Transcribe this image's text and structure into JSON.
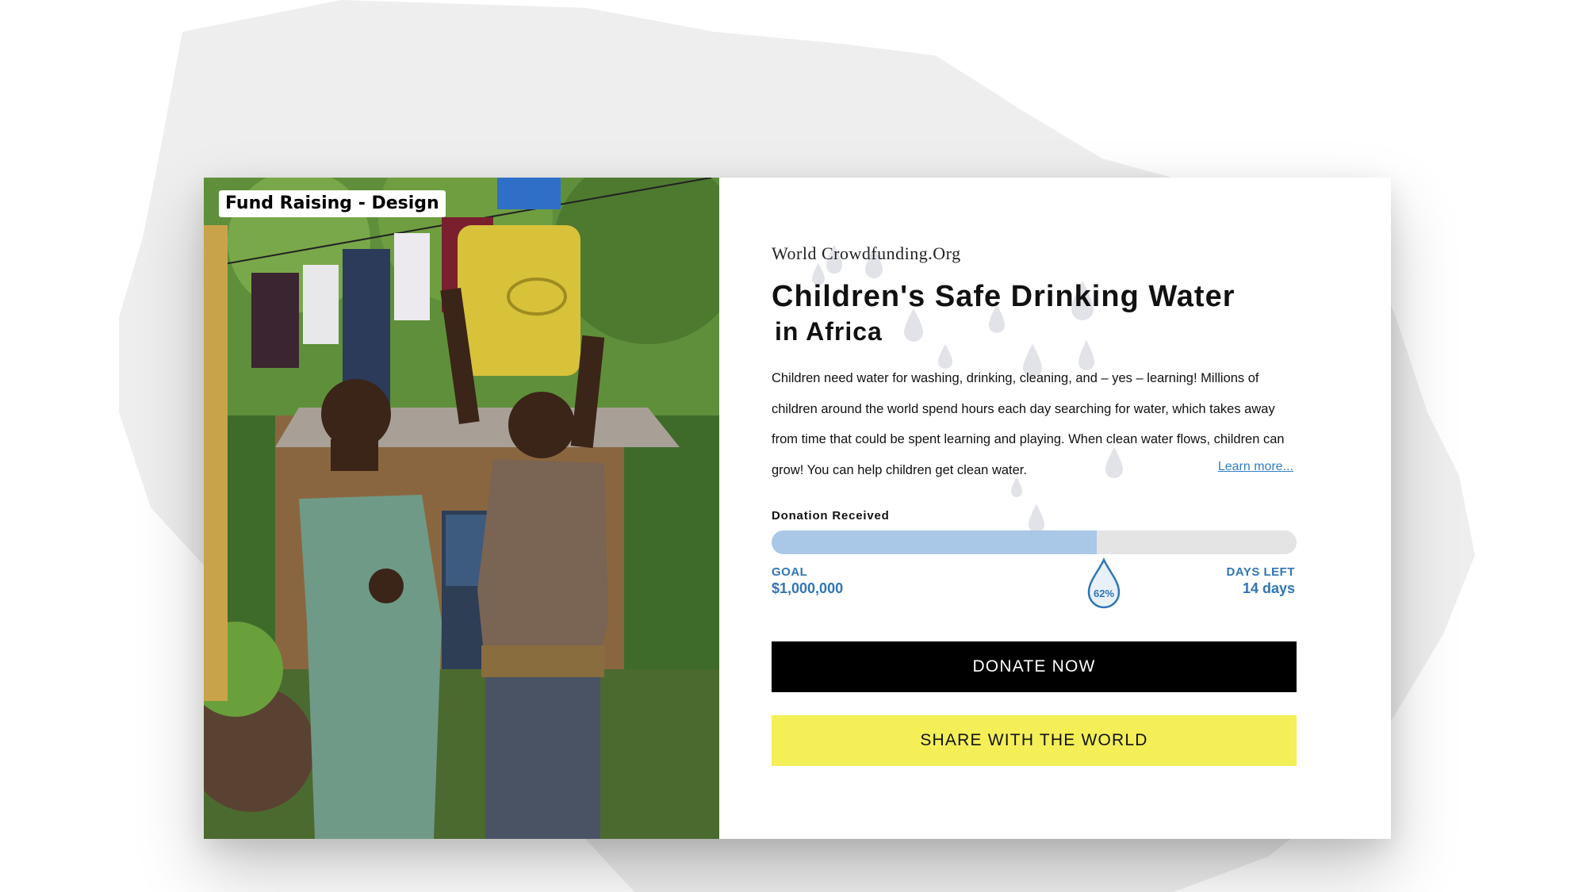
{
  "tag": "Fund Raising - Design",
  "org_name": "World Crowdfunding.Org",
  "title_line1": "Children's Safe Drinking Water",
  "title_line2": "in Africa",
  "description": "Children need water for washing, drinking, cleaning, and – yes – learning! Millions of children around the world spend hours each day searching for water, which takes away from time that could be spent learning and playing. When clean water flows, children can grow! You can help children get clean water.",
  "learn_more": "Learn more...",
  "donation_label": "Donation Received",
  "progress_percent": 62,
  "progress_text": "62%",
  "goal_label": "GOAL",
  "goal_value": "$1,000,000",
  "days_left_label": "DAYS LEFT",
  "days_left_value": "14 days",
  "donate_button": "DONATE NOW",
  "share_button": "SHARE WITH THE WORLD",
  "colors": {
    "accent_blue": "#2f75b5",
    "progress_fill": "#a9c7e6",
    "donate_bg": "#000000",
    "share_bg": "#f4ef56"
  },
  "photo_alt": "two-children-carrying-water-container"
}
